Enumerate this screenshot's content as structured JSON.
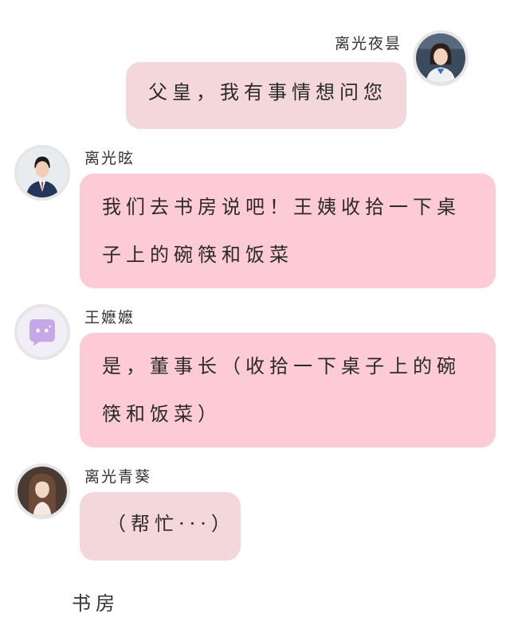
{
  "messages": [
    {
      "sender": "离光夜昙",
      "avatar_icon": "girl-avatar-icon",
      "lines": [
        "父皇，我有事情想问您"
      ],
      "bubble_color": "#f4d7da"
    },
    {
      "sender": "离光昡",
      "avatar_icon": "man-in-suit-avatar-icon",
      "lines": [
        "我们去书房说吧！王姨收拾一下桌",
        "子上的碗筷和饭菜"
      ],
      "bubble_color": "#fccbd5"
    },
    {
      "sender": "王嬷嬷",
      "avatar_icon": "purple-chat-bubble-icon",
      "lines": [
        "是，董事长（收拾一下桌子上的碗",
        "筷和饭菜）"
      ],
      "bubble_color": "#fccbd5"
    },
    {
      "sender": "离光青葵",
      "avatar_icon": "long-hair-girl-avatar-icon",
      "lines": [
        "（帮忙···）"
      ],
      "bubble_color": "#f4d7da"
    }
  ],
  "scene_caption": "书房"
}
